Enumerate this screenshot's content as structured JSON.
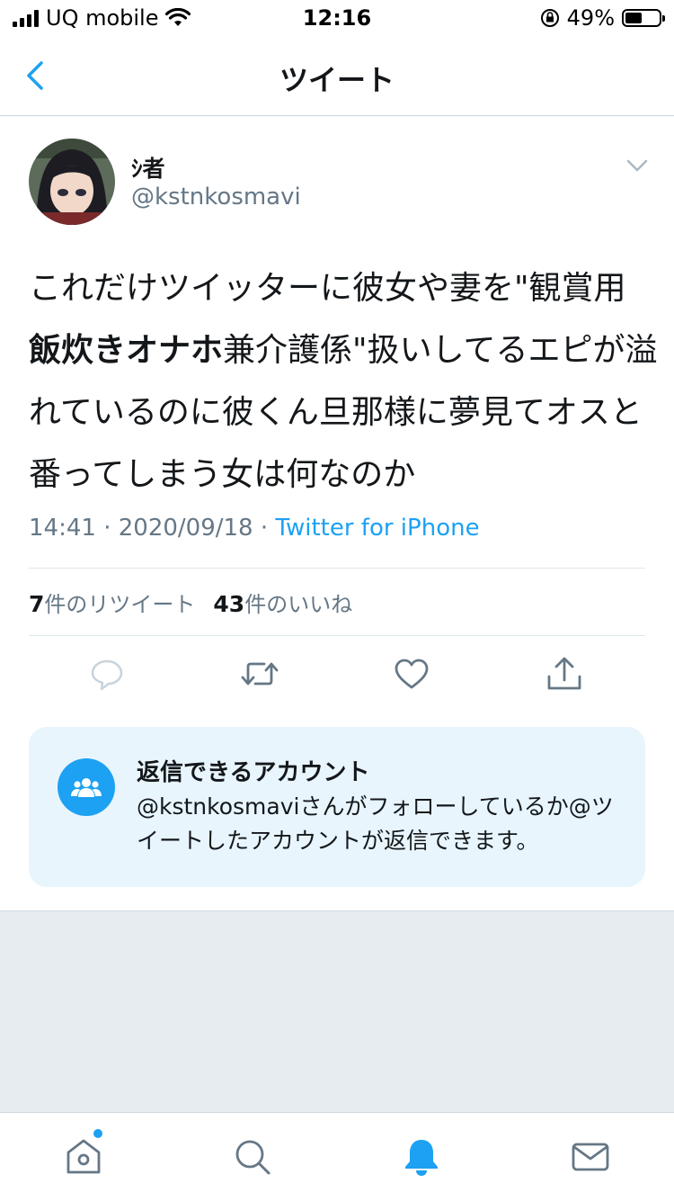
{
  "status_bar": {
    "carrier": "UQ mobile",
    "time": "12:16",
    "battery": "49%",
    "battery_level": 0.49
  },
  "nav": {
    "title": "ツイート",
    "back_icon": "chevron-left-icon"
  },
  "tweet": {
    "display_name": "ｼ者",
    "handle": "@kstnkosmavi",
    "text_parts": [
      "これだけツイッターに彼女や妻を\"観賞用",
      "飯炊きオナホ",
      "兼介護係\"扱いしてるエピが溢れているのに彼くん旦那様に夢見てオスと番ってしまう女は何なのか"
    ],
    "time": "14:41",
    "date": "2020/09/18",
    "source": "Twitter for iPhone",
    "retweet_count": "7",
    "retweet_label": "件のリツイート",
    "like_count": "43",
    "like_label": "件のいいね"
  },
  "reply_restriction": {
    "title": "返信できるアカウント",
    "description": "@kstnkosmaviさんがフォローしているか@ツイートしたアカウントが返信できます。"
  },
  "actions": [
    "reply-icon",
    "retweet-icon",
    "like-icon",
    "share-icon"
  ],
  "tabbar": {
    "tabs": [
      "home-icon",
      "search-icon",
      "notifications-icon",
      "messages-icon"
    ],
    "active": "notifications-icon"
  },
  "colors": {
    "accent": "#1da1f2",
    "secondary_text": "#657786",
    "reply_box_bg": "#e8f5fd"
  }
}
